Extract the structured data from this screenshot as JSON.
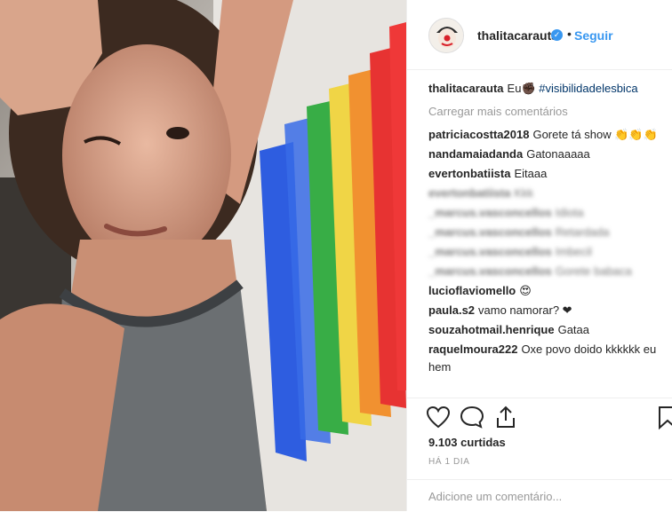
{
  "post": {
    "username": "thalitacarauta",
    "follow_label": "Seguir",
    "caption": {
      "user": "thalitacarauta",
      "text": "Eu",
      "emoji": "✊🏿",
      "hashtag": "#visibilidadelesbica"
    },
    "load_more": "Carregar mais comentários",
    "comments": [
      {
        "user": "patriciacostta2018",
        "text": "Gorete tá show 👏👏👏",
        "blurred": false
      },
      {
        "user": "nandamaiadanda",
        "text": "Gatonaaaaa",
        "blurred": false
      },
      {
        "user": "evertonbatiista",
        "text": "Eitaaa",
        "blurred": false
      },
      {
        "user": "evertonbatiista",
        "text": "Kkk",
        "blurred": true
      },
      {
        "user": "_marcus.vasconcellos",
        "text": "Idiota",
        "blurred": true
      },
      {
        "user": "_marcus.vasconcellos",
        "text": "Retardada",
        "blurred": true
      },
      {
        "user": "_marcus.vasconcellos",
        "text": "Imbecil",
        "blurred": true
      },
      {
        "user": "_marcus.vasconcellos",
        "text": "Gorete babaca",
        "blurred": true
      },
      {
        "user": "lucioflaviomello",
        "text": "😍",
        "blurred": false
      },
      {
        "user": "paula.s2",
        "text": "vamo namorar? ❤",
        "blurred": false
      },
      {
        "user": "souzahotmail.henrique",
        "text": "Gataa",
        "blurred": false
      },
      {
        "user": "raquelmoura222",
        "text": "Oxe povo doido kkkkkk eu hem",
        "blurred": false
      }
    ],
    "likes": "9.103 curtidas",
    "timestamp": "HÁ 1 DIA",
    "add_comment_placeholder": "Adicione um comentário...",
    "icons": [
      "heart-icon",
      "comment-icon",
      "share-icon",
      "bookmark-icon",
      "verified-icon"
    ],
    "colors": {
      "accent": "#3897f0",
      "text": "#262626",
      "muted": "#999999"
    }
  }
}
